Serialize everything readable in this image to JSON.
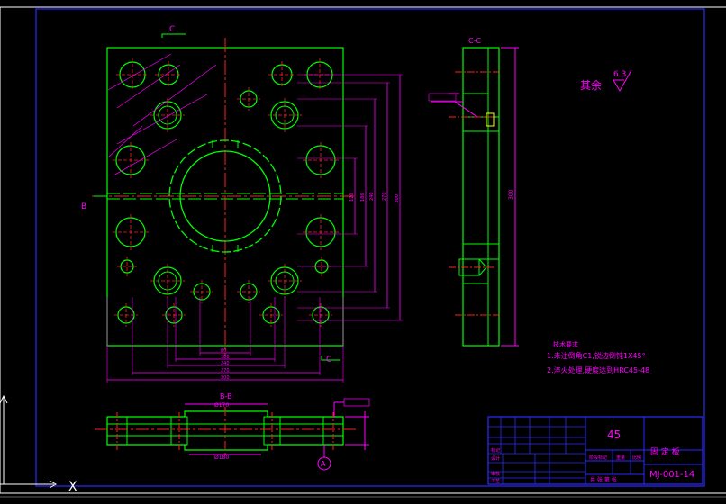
{
  "colors": {
    "background": "#000000",
    "frame": "#2323ff",
    "outline": "#00ff00",
    "dimension": "#ff00ff",
    "centerline": "#ff2020",
    "white": "#ffffff"
  },
  "labels": {
    "section_cut_top": "C",
    "section_cut_bottom": "C",
    "section_B_left": "B",
    "section_title_bb": "B-B",
    "section_title_cc": "C-C",
    "surface_rest": "其余",
    "surface_value": "6.3",
    "datum_a": "A",
    "axis_x": "X"
  },
  "notes": {
    "title": "技术要求",
    "line1": "1.未注倒角C1,锐边倒钝1X45°",
    "line2": "2.淬火处理,硬度达到HRC45-48"
  },
  "title_block": {
    "material": "45",
    "part_name": "固 定 板",
    "drawing_no": "MJ-001-14",
    "row_labels": [
      "标记",
      "设计",
      "审核",
      "工艺"
    ],
    "stage_label": "阶段标记",
    "weight_label": "重量",
    "scale_label": "比例",
    "sheet_label": "共  张 第  张"
  },
  "dimensions": {
    "bottom": [
      "80",
      "186",
      "240",
      "270",
      "300"
    ],
    "right": [
      "120",
      "186",
      "240",
      "270",
      "300"
    ],
    "bb_top": "Ø170",
    "bb_bottom": "Ø180",
    "cc_height": "300"
  }
}
